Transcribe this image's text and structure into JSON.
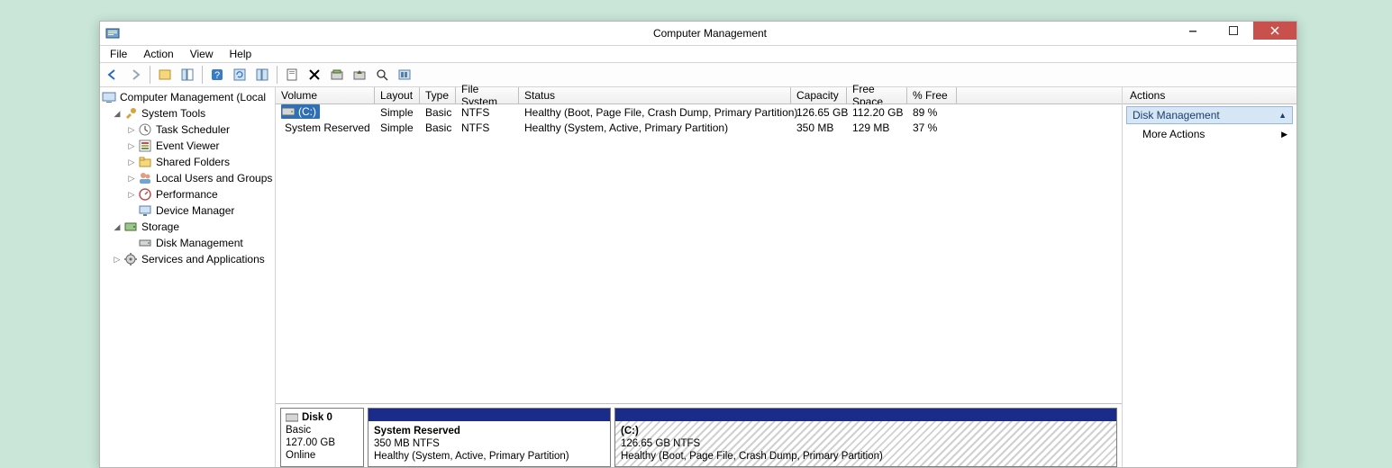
{
  "title": "Computer Management",
  "menu": {
    "file": "File",
    "action": "Action",
    "view": "View",
    "help": "Help"
  },
  "tree": {
    "root": "Computer Management (Local",
    "system_tools": "System Tools",
    "task_scheduler": "Task Scheduler",
    "event_viewer": "Event Viewer",
    "shared_folders": "Shared Folders",
    "local_users": "Local Users and Groups",
    "performance": "Performance",
    "device_manager": "Device Manager",
    "storage": "Storage",
    "disk_management": "Disk Management",
    "services_apps": "Services and Applications"
  },
  "columns": {
    "volume": "Volume",
    "layout": "Layout",
    "type": "Type",
    "filesystem": "File System",
    "status": "Status",
    "capacity": "Capacity",
    "freespace": "Free Space",
    "pctfree": "% Free"
  },
  "volumes": [
    {
      "name": "(C:)",
      "layout": "Simple",
      "type": "Basic",
      "fs": "NTFS",
      "status": "Healthy (Boot, Page File, Crash Dump, Primary Partition)",
      "capacity": "126.65 GB",
      "free": "112.20 GB",
      "pct": "89 %",
      "selected": true
    },
    {
      "name": "System Reserved",
      "layout": "Simple",
      "type": "Basic",
      "fs": "NTFS",
      "status": "Healthy (System, Active, Primary Partition)",
      "capacity": "350 MB",
      "free": "129 MB",
      "pct": "37 %",
      "selected": false
    }
  ],
  "disk": {
    "label": "Disk 0",
    "type": "Basic",
    "size": "127.00 GB",
    "state": "Online",
    "partitions": [
      {
        "title": "System Reserved",
        "size": "350 MB NTFS",
        "status": "Healthy (System, Active, Primary Partition)"
      },
      {
        "title": "(C:)",
        "size": "126.65 GB NTFS",
        "status": "Healthy (Boot, Page File, Crash Dump, Primary Partition)"
      }
    ]
  },
  "actions": {
    "header": "Actions",
    "section": "Disk Management",
    "item": "More Actions"
  }
}
